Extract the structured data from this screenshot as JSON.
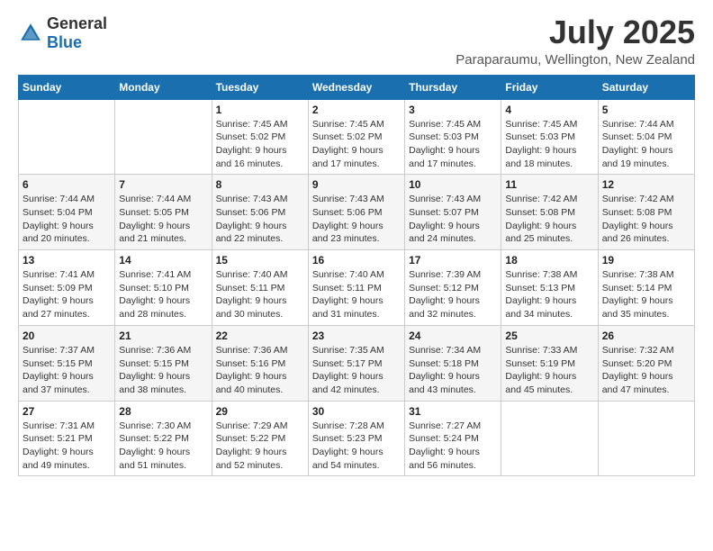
{
  "logo": {
    "general": "General",
    "blue": "Blue"
  },
  "title": "July 2025",
  "subtitle": "Paraparaumu, Wellington, New Zealand",
  "calendar": {
    "headers": [
      "Sunday",
      "Monday",
      "Tuesday",
      "Wednesday",
      "Thursday",
      "Friday",
      "Saturday"
    ],
    "weeks": [
      [
        {
          "day": "",
          "detail": ""
        },
        {
          "day": "",
          "detail": ""
        },
        {
          "day": "1",
          "detail": "Sunrise: 7:45 AM\nSunset: 5:02 PM\nDaylight: 9 hours and 16 minutes."
        },
        {
          "day": "2",
          "detail": "Sunrise: 7:45 AM\nSunset: 5:02 PM\nDaylight: 9 hours and 17 minutes."
        },
        {
          "day": "3",
          "detail": "Sunrise: 7:45 AM\nSunset: 5:03 PM\nDaylight: 9 hours and 17 minutes."
        },
        {
          "day": "4",
          "detail": "Sunrise: 7:45 AM\nSunset: 5:03 PM\nDaylight: 9 hours and 18 minutes."
        },
        {
          "day": "5",
          "detail": "Sunrise: 7:44 AM\nSunset: 5:04 PM\nDaylight: 9 hours and 19 minutes."
        }
      ],
      [
        {
          "day": "6",
          "detail": "Sunrise: 7:44 AM\nSunset: 5:04 PM\nDaylight: 9 hours and 20 minutes."
        },
        {
          "day": "7",
          "detail": "Sunrise: 7:44 AM\nSunset: 5:05 PM\nDaylight: 9 hours and 21 minutes."
        },
        {
          "day": "8",
          "detail": "Sunrise: 7:43 AM\nSunset: 5:06 PM\nDaylight: 9 hours and 22 minutes."
        },
        {
          "day": "9",
          "detail": "Sunrise: 7:43 AM\nSunset: 5:06 PM\nDaylight: 9 hours and 23 minutes."
        },
        {
          "day": "10",
          "detail": "Sunrise: 7:43 AM\nSunset: 5:07 PM\nDaylight: 9 hours and 24 minutes."
        },
        {
          "day": "11",
          "detail": "Sunrise: 7:42 AM\nSunset: 5:08 PM\nDaylight: 9 hours and 25 minutes."
        },
        {
          "day": "12",
          "detail": "Sunrise: 7:42 AM\nSunset: 5:08 PM\nDaylight: 9 hours and 26 minutes."
        }
      ],
      [
        {
          "day": "13",
          "detail": "Sunrise: 7:41 AM\nSunset: 5:09 PM\nDaylight: 9 hours and 27 minutes."
        },
        {
          "day": "14",
          "detail": "Sunrise: 7:41 AM\nSunset: 5:10 PM\nDaylight: 9 hours and 28 minutes."
        },
        {
          "day": "15",
          "detail": "Sunrise: 7:40 AM\nSunset: 5:11 PM\nDaylight: 9 hours and 30 minutes."
        },
        {
          "day": "16",
          "detail": "Sunrise: 7:40 AM\nSunset: 5:11 PM\nDaylight: 9 hours and 31 minutes."
        },
        {
          "day": "17",
          "detail": "Sunrise: 7:39 AM\nSunset: 5:12 PM\nDaylight: 9 hours and 32 minutes."
        },
        {
          "day": "18",
          "detail": "Sunrise: 7:38 AM\nSunset: 5:13 PM\nDaylight: 9 hours and 34 minutes."
        },
        {
          "day": "19",
          "detail": "Sunrise: 7:38 AM\nSunset: 5:14 PM\nDaylight: 9 hours and 35 minutes."
        }
      ],
      [
        {
          "day": "20",
          "detail": "Sunrise: 7:37 AM\nSunset: 5:15 PM\nDaylight: 9 hours and 37 minutes."
        },
        {
          "day": "21",
          "detail": "Sunrise: 7:36 AM\nSunset: 5:15 PM\nDaylight: 9 hours and 38 minutes."
        },
        {
          "day": "22",
          "detail": "Sunrise: 7:36 AM\nSunset: 5:16 PM\nDaylight: 9 hours and 40 minutes."
        },
        {
          "day": "23",
          "detail": "Sunrise: 7:35 AM\nSunset: 5:17 PM\nDaylight: 9 hours and 42 minutes."
        },
        {
          "day": "24",
          "detail": "Sunrise: 7:34 AM\nSunset: 5:18 PM\nDaylight: 9 hours and 43 minutes."
        },
        {
          "day": "25",
          "detail": "Sunrise: 7:33 AM\nSunset: 5:19 PM\nDaylight: 9 hours and 45 minutes."
        },
        {
          "day": "26",
          "detail": "Sunrise: 7:32 AM\nSunset: 5:20 PM\nDaylight: 9 hours and 47 minutes."
        }
      ],
      [
        {
          "day": "27",
          "detail": "Sunrise: 7:31 AM\nSunset: 5:21 PM\nDaylight: 9 hours and 49 minutes."
        },
        {
          "day": "28",
          "detail": "Sunrise: 7:30 AM\nSunset: 5:22 PM\nDaylight: 9 hours and 51 minutes."
        },
        {
          "day": "29",
          "detail": "Sunrise: 7:29 AM\nSunset: 5:22 PM\nDaylight: 9 hours and 52 minutes."
        },
        {
          "day": "30",
          "detail": "Sunrise: 7:28 AM\nSunset: 5:23 PM\nDaylight: 9 hours and 54 minutes."
        },
        {
          "day": "31",
          "detail": "Sunrise: 7:27 AM\nSunset: 5:24 PM\nDaylight: 9 hours and 56 minutes."
        },
        {
          "day": "",
          "detail": ""
        },
        {
          "day": "",
          "detail": ""
        }
      ]
    ]
  }
}
